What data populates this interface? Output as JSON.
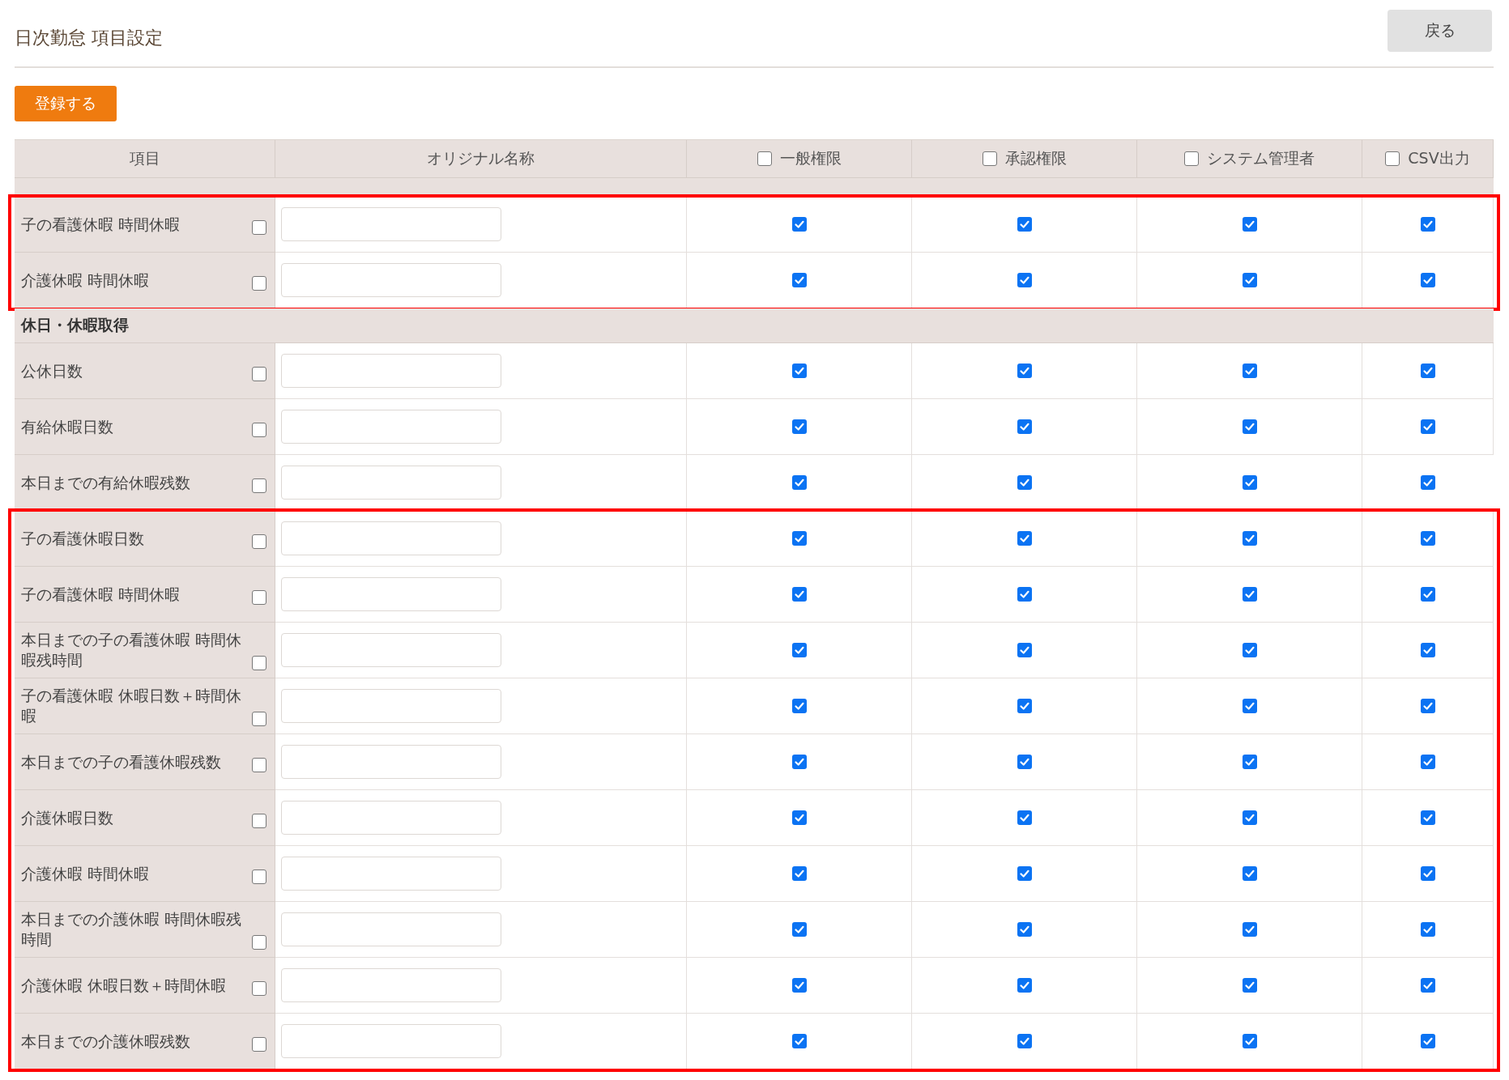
{
  "page": {
    "title": "日次勤怠 項目設定",
    "back_button": "戻る",
    "submit_button": "登録する"
  },
  "table": {
    "columns": [
      {
        "kind": "plain",
        "label": "項目"
      },
      {
        "kind": "plain",
        "label": "オリジナル名称"
      },
      {
        "kind": "checkbox",
        "label": "一般権限",
        "checked": false
      },
      {
        "kind": "checkbox",
        "label": "承認権限",
        "checked": false
      },
      {
        "kind": "checkbox",
        "label": "システム管理者",
        "checked": false
      },
      {
        "kind": "checkbox",
        "label": "CSV出力",
        "checked": false
      }
    ],
    "blocks": [
      {
        "highlighted": true,
        "rows": [
          {
            "kind": "item",
            "label": "子の看護休暇 時間休暇",
            "checked": false,
            "permissions": [
              true,
              true,
              true,
              true
            ]
          },
          {
            "kind": "item",
            "label": "介護休暇 時間休暇",
            "checked": false,
            "permissions": [
              true,
              true,
              true,
              true
            ]
          }
        ]
      },
      {
        "highlighted": false,
        "rows": [
          {
            "kind": "section",
            "label": "休日・休暇取得"
          },
          {
            "kind": "item",
            "label": "公休日数",
            "checked": false,
            "permissions": [
              true,
              true,
              true,
              true
            ]
          },
          {
            "kind": "item",
            "label": "有給休暇日数",
            "checked": false,
            "permissions": [
              true,
              true,
              true,
              true
            ]
          },
          {
            "kind": "item",
            "label": "本日までの有給休暇残数",
            "checked": false,
            "permissions": [
              true,
              true,
              true,
              true
            ]
          }
        ]
      },
      {
        "highlighted": true,
        "rows": [
          {
            "kind": "item",
            "label": "子の看護休暇日数",
            "checked": false,
            "permissions": [
              true,
              true,
              true,
              true
            ]
          },
          {
            "kind": "item",
            "label": "子の看護休暇 時間休暇",
            "checked": false,
            "permissions": [
              true,
              true,
              true,
              true
            ]
          },
          {
            "kind": "item",
            "label": "本日までの子の看護休暇 時間休暇残時間",
            "checked": false,
            "permissions": [
              true,
              true,
              true,
              true
            ]
          },
          {
            "kind": "item",
            "label": "子の看護休暇 休暇日数＋時間休暇",
            "checked": false,
            "permissions": [
              true,
              true,
              true,
              true
            ]
          },
          {
            "kind": "item",
            "label": "本日までの子の看護休暇残数",
            "checked": false,
            "permissions": [
              true,
              true,
              true,
              true
            ]
          },
          {
            "kind": "item",
            "label": "介護休暇日数",
            "checked": false,
            "permissions": [
              true,
              true,
              true,
              true
            ]
          },
          {
            "kind": "item",
            "label": "介護休暇 時間休暇",
            "checked": false,
            "permissions": [
              true,
              true,
              true,
              true
            ]
          },
          {
            "kind": "item",
            "label": "本日までの介護休暇 時間休暇残時間",
            "checked": false,
            "permissions": [
              true,
              true,
              true,
              true
            ]
          },
          {
            "kind": "item",
            "label": "介護休暇 休暇日数＋時間休暇",
            "checked": false,
            "permissions": [
              true,
              true,
              true,
              true
            ]
          },
          {
            "kind": "item",
            "label": "本日までの介護休暇残数",
            "checked": false,
            "permissions": [
              true,
              true,
              true,
              true
            ]
          }
        ]
      }
    ]
  }
}
